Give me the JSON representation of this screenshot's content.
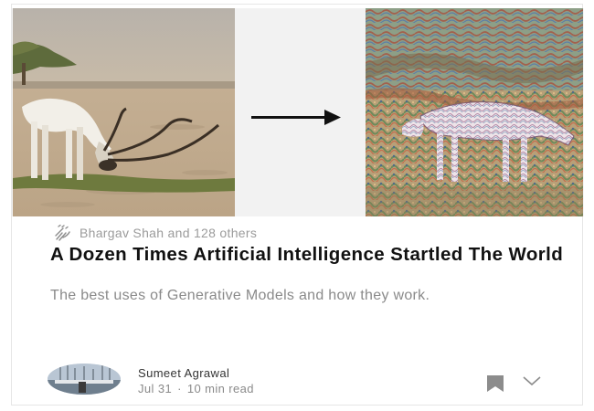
{
  "story": {
    "recommend_text": "Bhargav Shah and 128 others",
    "title": "A Dozen Times Artificial Intelligence Startled The World",
    "subtitle": "The best uses of Generative Models and how they work.",
    "author": "Sumeet Agrawal",
    "date": "Jul 31",
    "separator": "·",
    "read_time": "10 min read"
  },
  "icons": {
    "clap": "clap-icon",
    "arrow": "right-arrow-icon",
    "bookmark": "bookmark-icon",
    "more": "chevron-down-icon"
  },
  "colors": {
    "title": "#111111",
    "muted": "#9b9b9b",
    "icon": "#8c8c8c"
  }
}
